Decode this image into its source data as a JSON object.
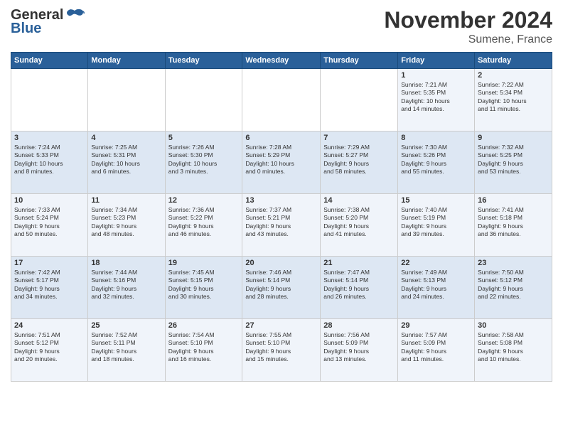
{
  "header": {
    "logo_general": "General",
    "logo_blue": "Blue",
    "month": "November 2024",
    "location": "Sumene, France"
  },
  "weekdays": [
    "Sunday",
    "Monday",
    "Tuesday",
    "Wednesday",
    "Thursday",
    "Friday",
    "Saturday"
  ],
  "weeks": [
    [
      {
        "day": "",
        "info": ""
      },
      {
        "day": "",
        "info": ""
      },
      {
        "day": "",
        "info": ""
      },
      {
        "day": "",
        "info": ""
      },
      {
        "day": "",
        "info": ""
      },
      {
        "day": "1",
        "info": "Sunrise: 7:21 AM\nSunset: 5:35 PM\nDaylight: 10 hours\nand 14 minutes."
      },
      {
        "day": "2",
        "info": "Sunrise: 7:22 AM\nSunset: 5:34 PM\nDaylight: 10 hours\nand 11 minutes."
      }
    ],
    [
      {
        "day": "3",
        "info": "Sunrise: 7:24 AM\nSunset: 5:33 PM\nDaylight: 10 hours\nand 8 minutes."
      },
      {
        "day": "4",
        "info": "Sunrise: 7:25 AM\nSunset: 5:31 PM\nDaylight: 10 hours\nand 6 minutes."
      },
      {
        "day": "5",
        "info": "Sunrise: 7:26 AM\nSunset: 5:30 PM\nDaylight: 10 hours\nand 3 minutes."
      },
      {
        "day": "6",
        "info": "Sunrise: 7:28 AM\nSunset: 5:29 PM\nDaylight: 10 hours\nand 0 minutes."
      },
      {
        "day": "7",
        "info": "Sunrise: 7:29 AM\nSunset: 5:27 PM\nDaylight: 9 hours\nand 58 minutes."
      },
      {
        "day": "8",
        "info": "Sunrise: 7:30 AM\nSunset: 5:26 PM\nDaylight: 9 hours\nand 55 minutes."
      },
      {
        "day": "9",
        "info": "Sunrise: 7:32 AM\nSunset: 5:25 PM\nDaylight: 9 hours\nand 53 minutes."
      }
    ],
    [
      {
        "day": "10",
        "info": "Sunrise: 7:33 AM\nSunset: 5:24 PM\nDaylight: 9 hours\nand 50 minutes."
      },
      {
        "day": "11",
        "info": "Sunrise: 7:34 AM\nSunset: 5:23 PM\nDaylight: 9 hours\nand 48 minutes."
      },
      {
        "day": "12",
        "info": "Sunrise: 7:36 AM\nSunset: 5:22 PM\nDaylight: 9 hours\nand 46 minutes."
      },
      {
        "day": "13",
        "info": "Sunrise: 7:37 AM\nSunset: 5:21 PM\nDaylight: 9 hours\nand 43 minutes."
      },
      {
        "day": "14",
        "info": "Sunrise: 7:38 AM\nSunset: 5:20 PM\nDaylight: 9 hours\nand 41 minutes."
      },
      {
        "day": "15",
        "info": "Sunrise: 7:40 AM\nSunset: 5:19 PM\nDaylight: 9 hours\nand 39 minutes."
      },
      {
        "day": "16",
        "info": "Sunrise: 7:41 AM\nSunset: 5:18 PM\nDaylight: 9 hours\nand 36 minutes."
      }
    ],
    [
      {
        "day": "17",
        "info": "Sunrise: 7:42 AM\nSunset: 5:17 PM\nDaylight: 9 hours\nand 34 minutes."
      },
      {
        "day": "18",
        "info": "Sunrise: 7:44 AM\nSunset: 5:16 PM\nDaylight: 9 hours\nand 32 minutes."
      },
      {
        "day": "19",
        "info": "Sunrise: 7:45 AM\nSunset: 5:15 PM\nDaylight: 9 hours\nand 30 minutes."
      },
      {
        "day": "20",
        "info": "Sunrise: 7:46 AM\nSunset: 5:14 PM\nDaylight: 9 hours\nand 28 minutes."
      },
      {
        "day": "21",
        "info": "Sunrise: 7:47 AM\nSunset: 5:14 PM\nDaylight: 9 hours\nand 26 minutes."
      },
      {
        "day": "22",
        "info": "Sunrise: 7:49 AM\nSunset: 5:13 PM\nDaylight: 9 hours\nand 24 minutes."
      },
      {
        "day": "23",
        "info": "Sunrise: 7:50 AM\nSunset: 5:12 PM\nDaylight: 9 hours\nand 22 minutes."
      }
    ],
    [
      {
        "day": "24",
        "info": "Sunrise: 7:51 AM\nSunset: 5:12 PM\nDaylight: 9 hours\nand 20 minutes."
      },
      {
        "day": "25",
        "info": "Sunrise: 7:52 AM\nSunset: 5:11 PM\nDaylight: 9 hours\nand 18 minutes."
      },
      {
        "day": "26",
        "info": "Sunrise: 7:54 AM\nSunset: 5:10 PM\nDaylight: 9 hours\nand 16 minutes."
      },
      {
        "day": "27",
        "info": "Sunrise: 7:55 AM\nSunset: 5:10 PM\nDaylight: 9 hours\nand 15 minutes."
      },
      {
        "day": "28",
        "info": "Sunrise: 7:56 AM\nSunset: 5:09 PM\nDaylight: 9 hours\nand 13 minutes."
      },
      {
        "day": "29",
        "info": "Sunrise: 7:57 AM\nSunset: 5:09 PM\nDaylight: 9 hours\nand 11 minutes."
      },
      {
        "day": "30",
        "info": "Sunrise: 7:58 AM\nSunset: 5:08 PM\nDaylight: 9 hours\nand 10 minutes."
      }
    ]
  ]
}
